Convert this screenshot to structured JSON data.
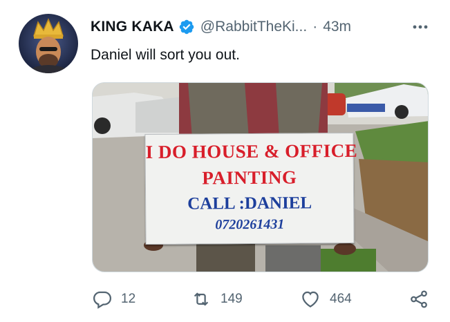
{
  "tweet": {
    "author_name": "KING KAKA",
    "author_handle": "@RabbitTheKi...",
    "separator": "·",
    "time": "43m",
    "text": "Daniel will sort you out."
  },
  "image": {
    "sign_line1": "I DO HOUSE & OFFICE",
    "sign_line2": "PAINTING",
    "sign_line3": "CALL :DANIEL",
    "sign_line4": "0720261431",
    "sign_red": "#d81e2a",
    "sign_blue": "#1d3f9c"
  },
  "actions": {
    "reply_count": "12",
    "retweet_count": "149",
    "like_count": "464"
  },
  "icons": {
    "verified": "verified-badge-icon",
    "more": "more-options-icon",
    "reply": "reply-icon",
    "retweet": "retweet-icon",
    "like": "like-icon",
    "share": "share-icon"
  },
  "colors": {
    "verified": "#1d9bf0",
    "secondary_text": "#536471"
  }
}
